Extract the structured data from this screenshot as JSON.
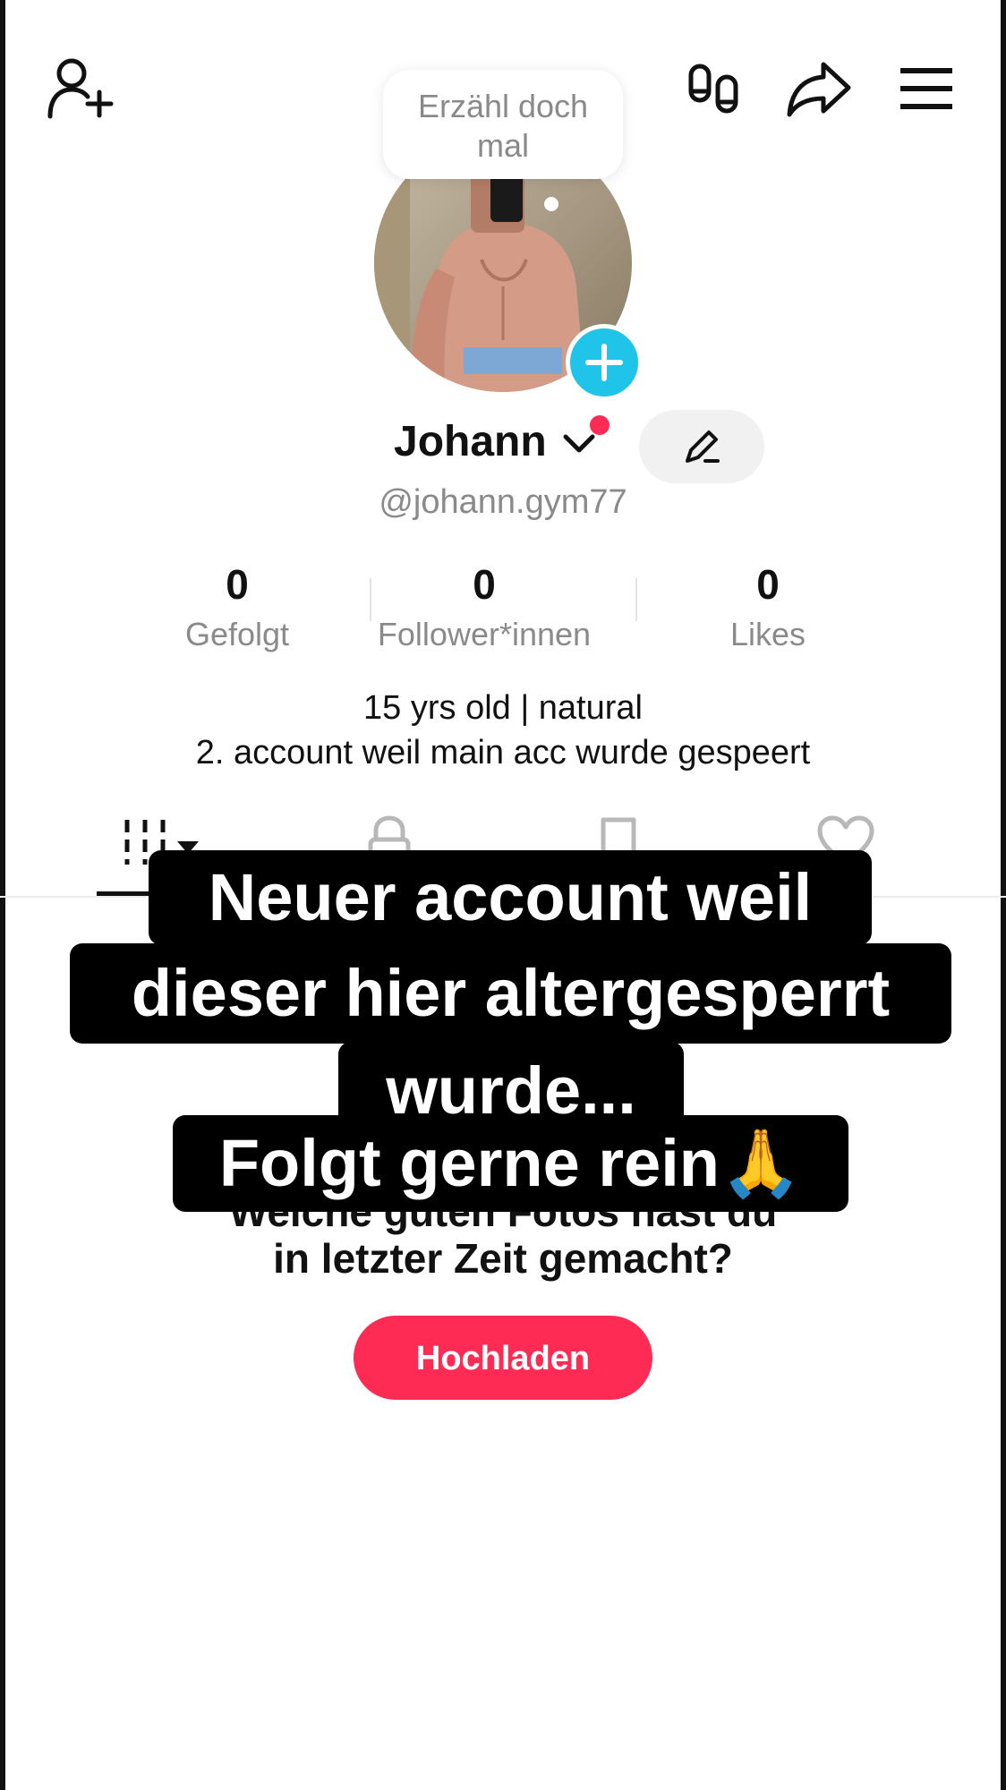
{
  "header": {
    "add_friend_icon": "person-plus-icon",
    "footprints_icon": "footprints-icon",
    "share_icon": "share-arrow-icon",
    "menu_icon": "hamburger-menu-icon"
  },
  "profile": {
    "bubble_text_1": "Erzähl doch",
    "bubble_text_2": "mal",
    "name": "Johann",
    "handle": "@johann.gym77",
    "stats": [
      {
        "value": "0",
        "label": "Gefolgt"
      },
      {
        "value": "0",
        "label": "Follower*innen"
      },
      {
        "value": "0",
        "label": "Likes"
      }
    ],
    "bio_line_1": "15 yrs old | natural",
    "bio_line_2": "2. account weil main acc wurde gespeert"
  },
  "tabs": [
    {
      "icon": "grid-icon"
    },
    {
      "icon": "lock-icon"
    },
    {
      "icon": "bookmark-icon"
    },
    {
      "icon": "heart-icon"
    }
  ],
  "empty_state": {
    "line_1": "Welche guten Fotos hast du",
    "line_2": "in letzter Zeit gemacht?",
    "upload_label": "Hochladen"
  },
  "overlay": {
    "line_1": "Neuer account weil",
    "line_2": "dieser hier altergesperrt",
    "line_3": "wurde...",
    "line_4": "Folgt gerne rein🙏"
  },
  "colors": {
    "accent": "#fe2c55",
    "plus": "#20c4e8",
    "muted": "#8a8a8a"
  }
}
